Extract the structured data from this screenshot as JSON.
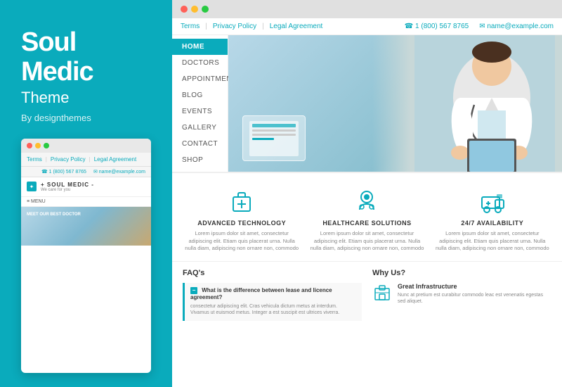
{
  "left": {
    "title_line1": "Soul",
    "title_line2": "Medic",
    "subtitle": "Theme",
    "by": "By designthemes"
  },
  "mini_browser": {
    "nav_links": [
      "Terms",
      "Privacy Policy",
      "Legal Agreement"
    ],
    "phone": "1 (800) 567 8765",
    "email": "name@example.com",
    "logo": "SOUL MEDIC -",
    "logo_sub": "We care for you",
    "menu": "≡  MENU"
  },
  "browser": {
    "nav_links": [
      "Terms",
      "Privacy Policy",
      "Legal Agreement"
    ],
    "phone": "1 (800) 567 8765",
    "email": "name@example.com",
    "nav_items": [
      "HOME",
      "DOCTORS",
      "APPOINTMENTS",
      "BLOG",
      "EVENTS",
      "GALLERY",
      "CONTACT",
      "SHOP"
    ]
  },
  "features": [
    {
      "icon": "medical-bag",
      "title": "ADVANCED TECHNOLOGY",
      "text": "Lorem ipsum dolor sit amet, consectetur adipiscing elit. Etiam quis placerat urna. Nulla nulla diam, adipiscing non ornare non, commodo"
    },
    {
      "icon": "healthcare",
      "title": "HEALTHCARE SOLUTIONS",
      "text": "Lorem ipsum dolor sit amet, consectetur adipiscing elit. Etiam quis placerat urna. Nulla nulla diam, adipiscing non ornare non, commodo"
    },
    {
      "icon": "ambulance",
      "title": "24/7 AVAILABILITY",
      "text": "Lorem ipsum dolor sit amet, consectetur adipiscing elit. Etiam quis placerat urna. Nulla nulla diam, adipiscing non ornare non, commodo"
    }
  ],
  "faq": {
    "title": "FAQ's",
    "question": "What is the difference between lease and licence agreement?",
    "answer1": "consectetur adipiscing elit. Cras vehicula dictum metus at interdum.",
    "answer2": "Vivamus ut euismod metus. Integer a est suscipit est ultrices viverra."
  },
  "why": {
    "title": "Why Us?",
    "item_title": "Great Infrastructure",
    "item_text": "Nunc at pretium est curabitur commodo leac est venenatis egestas sed aliquet."
  },
  "accent_color": "#0aabbc"
}
